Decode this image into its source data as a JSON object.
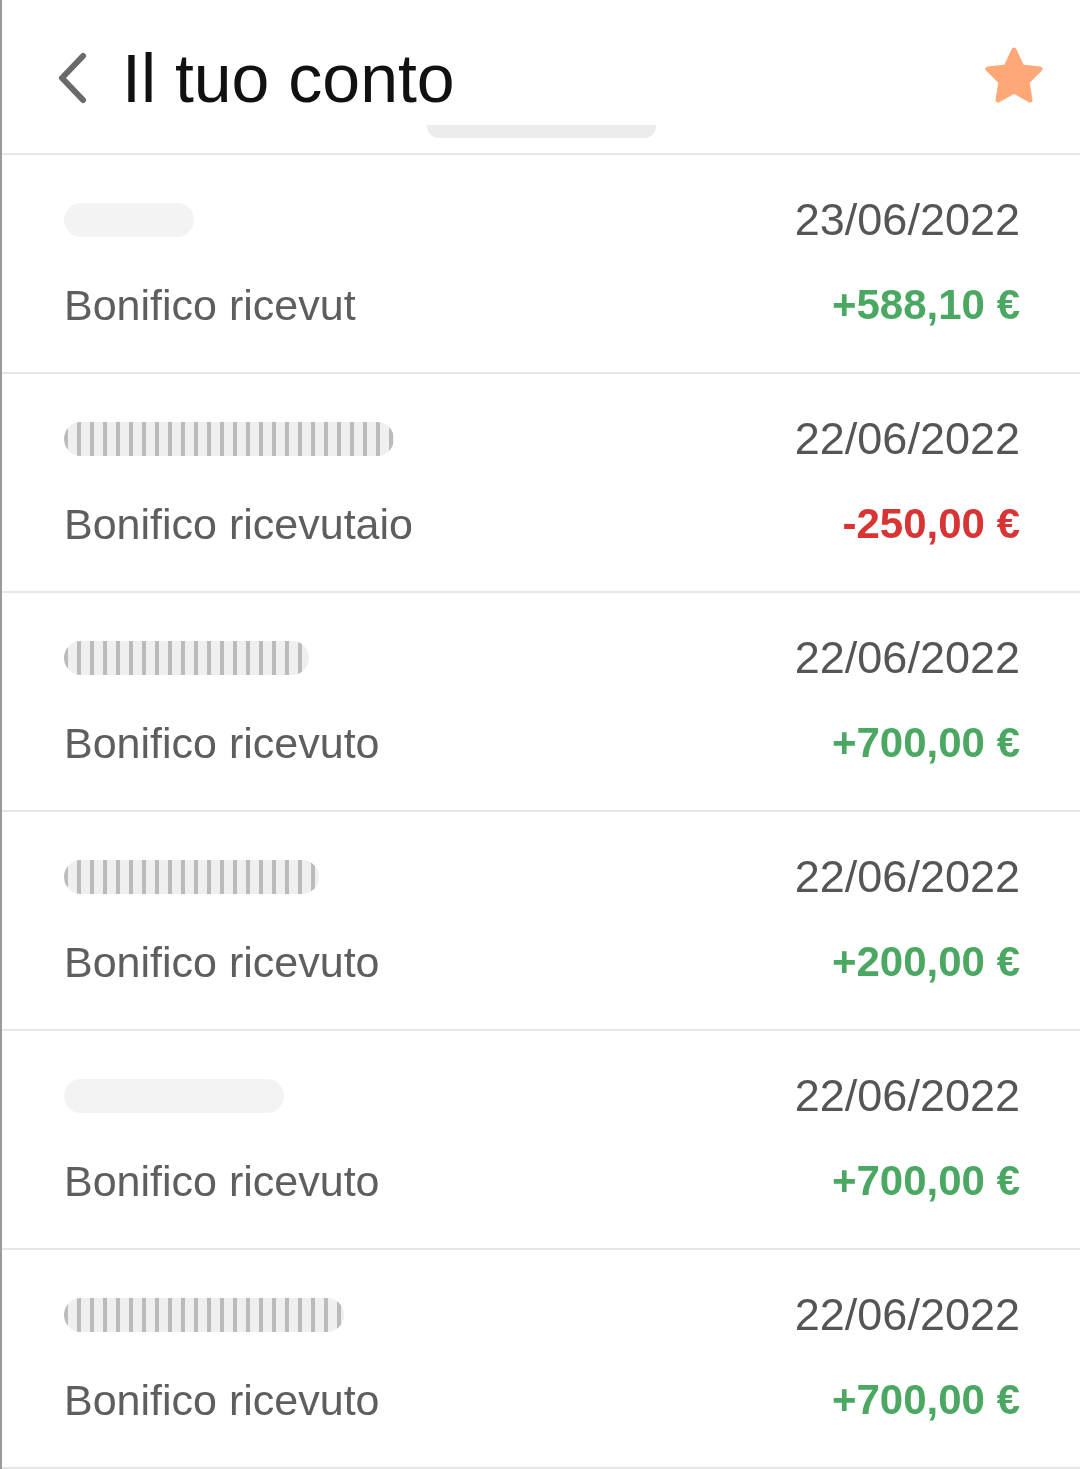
{
  "header": {
    "title": "Il tuo conto",
    "favorite": true
  },
  "transactions": [
    {
      "name_hidden": true,
      "date": "23/06/2022",
      "description": "Bonifico ricevut",
      "amount": "+588,10 €",
      "kind": "credit"
    },
    {
      "name_hidden": true,
      "date": "22/06/2022",
      "description": "Bonifico ricevutaio",
      "amount": "-250,00 €",
      "kind": "debit"
    },
    {
      "name_hidden": true,
      "date": "22/06/2022",
      "description": "Bonifico ricevuto",
      "amount": "+700,00 €",
      "kind": "credit"
    },
    {
      "name_hidden": true,
      "date": "22/06/2022",
      "description": "Bonifico ricevuto",
      "amount": "+200,00 €",
      "kind": "credit"
    },
    {
      "name_hidden": true,
      "date": "22/06/2022",
      "description": "Bonifico ricevuto",
      "amount": "+700,00 €",
      "kind": "credit"
    },
    {
      "name_hidden": true,
      "date": "22/06/2022",
      "description": "Bonifico ricevuto",
      "amount": "+700,00 €",
      "kind": "credit"
    }
  ]
}
